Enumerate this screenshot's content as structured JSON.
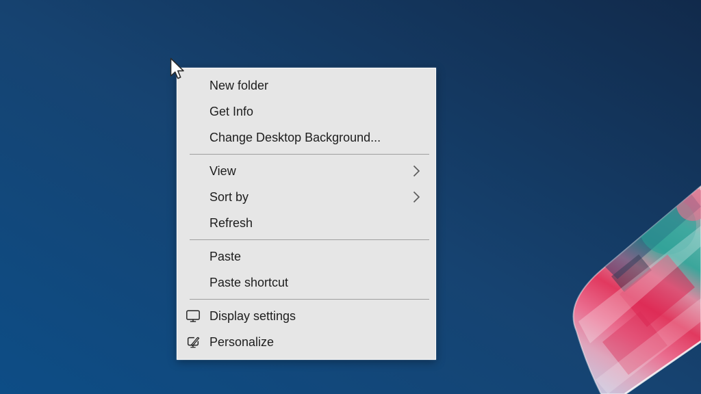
{
  "desktop": {
    "bg_gradient": {
      "top_right": "#112a4b",
      "middle": "#164371",
      "bottom_left": "#0d4d86"
    }
  },
  "context_menu": {
    "bg_color": "#e6e6e6",
    "text_color": "#1d1d1d",
    "separator_color": "#9e9e9e",
    "chevron_color": "#5c5c5c",
    "sections": [
      {
        "items": [
          {
            "label": "New folder"
          },
          {
            "label": "Get Info"
          },
          {
            "label": "Change Desktop Background..."
          }
        ]
      },
      {
        "items": [
          {
            "label": "View",
            "submenu": true
          },
          {
            "label": "Sort by",
            "submenu": true
          },
          {
            "label": "Refresh"
          }
        ]
      },
      {
        "items": [
          {
            "label": "Paste"
          },
          {
            "label": "Paste shortcut"
          }
        ]
      },
      {
        "items": [
          {
            "label": "Display settings",
            "icon": "display-settings-icon"
          },
          {
            "label": "Personalize",
            "icon": "personalize-icon"
          }
        ]
      }
    ]
  },
  "wallpaper": {
    "shape": "glass-prism",
    "edge_highlight": "#ffffff",
    "gradient_stops": [
      {
        "offset": "0%",
        "color": "#c9c3db"
      },
      {
        "offset": "14%",
        "color": "#dfa6bd"
      },
      {
        "offset": "27%",
        "color": "#ea6e90"
      },
      {
        "offset": "42%",
        "color": "#e1395f"
      },
      {
        "offset": "55%",
        "color": "#db89a0"
      },
      {
        "offset": "67%",
        "color": "#3ba69b"
      },
      {
        "offset": "80%",
        "color": "#58b2a9"
      },
      {
        "offset": "91%",
        "color": "#bd8fa3"
      },
      {
        "offset": "100%",
        "color": "#e8a2ae"
      }
    ],
    "accents": {
      "red_block": "#dc1f4e",
      "teal": "#2ba197",
      "dark_patch": "#323a52",
      "navy_tint": "#16396b"
    }
  },
  "cursor": {
    "type": "arrow-pointer",
    "fill": "#ffffff",
    "outline": "#2b2b2b"
  }
}
